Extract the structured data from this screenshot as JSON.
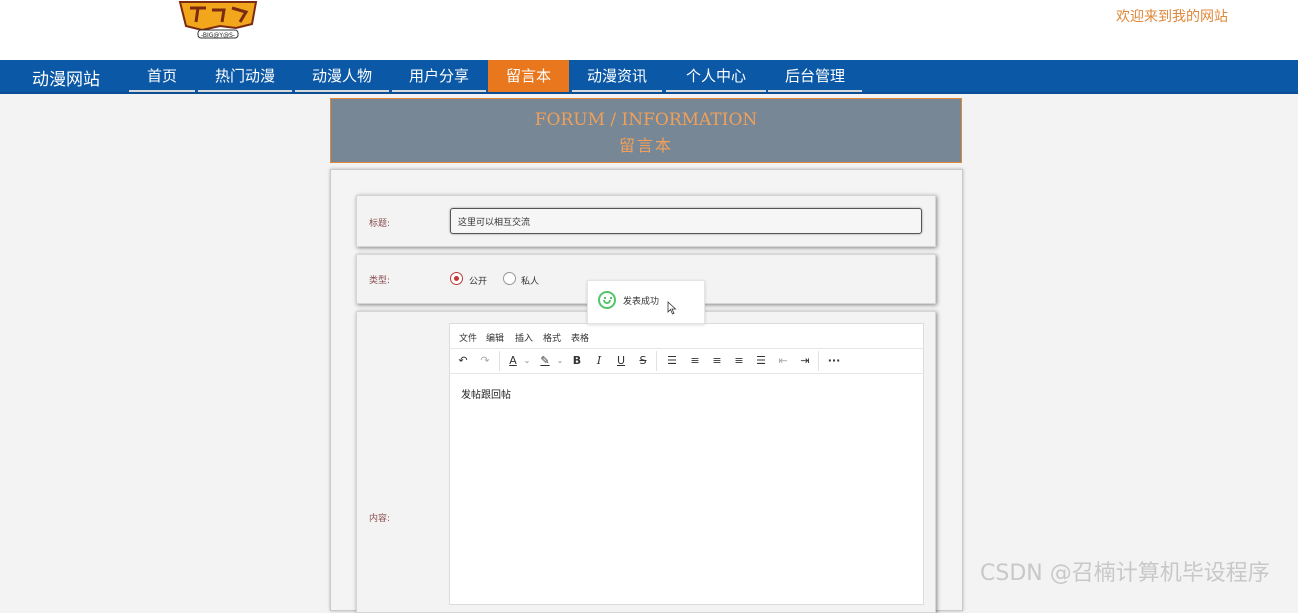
{
  "header": {
    "logo_text": "BIGGYS",
    "welcome": "欢迎来到我的网站"
  },
  "nav": {
    "brand": "动漫网站",
    "items": [
      {
        "label": "首页"
      },
      {
        "label": "热门动漫"
      },
      {
        "label": "动漫人物"
      },
      {
        "label": "用户分享"
      },
      {
        "label": "留言本",
        "active": true
      },
      {
        "label": "动漫资讯"
      },
      {
        "label": "个人中心"
      },
      {
        "label": "后台管理"
      }
    ]
  },
  "banner": {
    "en": "FORUM / INFORMATION",
    "cn": "留言本"
  },
  "form": {
    "title_label": "标题:",
    "title_value": "这里可以相互交流",
    "type_label": "类型:",
    "type_options": [
      {
        "label": "公开",
        "selected": true
      },
      {
        "label": "私人",
        "selected": false
      }
    ],
    "content_label": "内容:"
  },
  "toast": {
    "message": "发表成功"
  },
  "editor": {
    "menu": [
      "文件",
      "编辑",
      "插入",
      "格式",
      "表格"
    ],
    "toolbar_icons": [
      "undo-icon",
      "redo-icon",
      "font-color-icon",
      "highlight-icon",
      "bold-icon",
      "italic-icon",
      "underline-icon",
      "strikethrough-icon",
      "line-height-icon",
      "align-left-icon",
      "align-center-icon",
      "align-right-icon",
      "justify-icon",
      "outdent-icon",
      "indent-icon",
      "more-icon"
    ],
    "content": "发帖跟回帖"
  },
  "watermark": "CSDN @召楠计算机毕设程序",
  "colors": {
    "nav_bg": "#0b58a6",
    "active_tab": "#e8771e",
    "accent": "#e0883a",
    "banner_bg": "#778796"
  }
}
